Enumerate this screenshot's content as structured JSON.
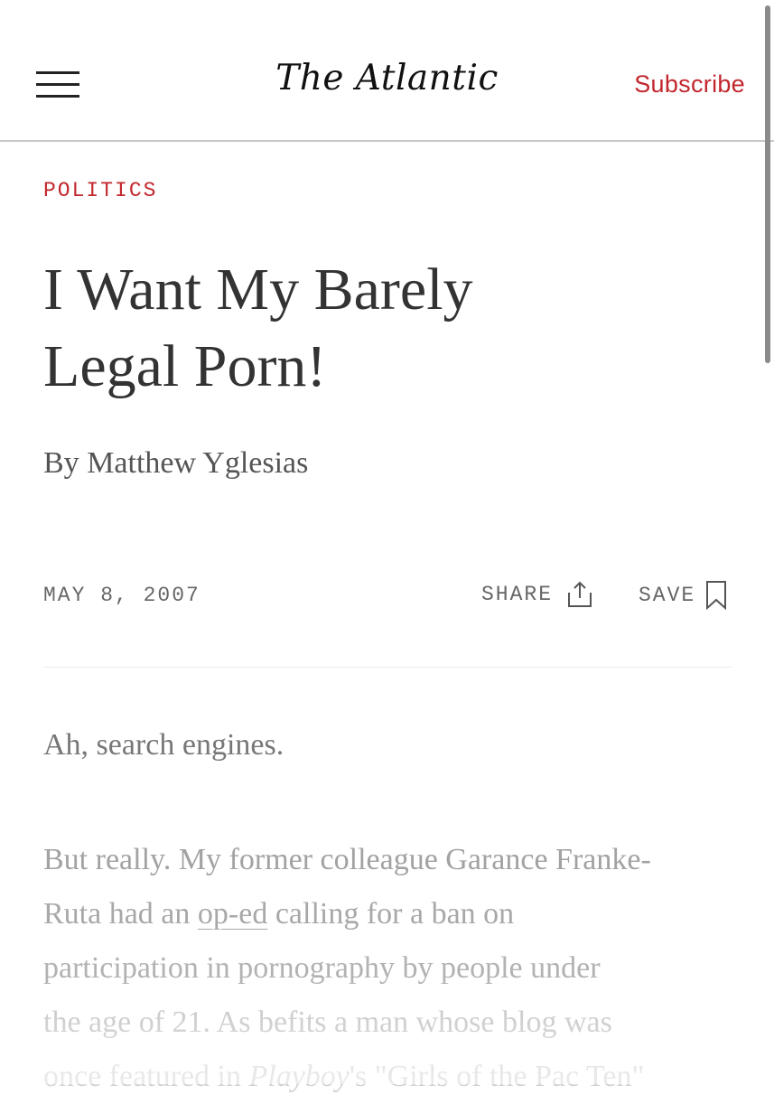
{
  "header": {
    "logo": "The Atlantic",
    "subscribe_label": "Subscribe",
    "menu_icon": "hamburger-menu-icon"
  },
  "article": {
    "section": "POLITICS",
    "title_line1": "I Want My Barely",
    "title_line2": "Legal Porn!",
    "byline_prefix": "By ",
    "author": "Matthew Yglesias",
    "date": "MAY 8, 2007",
    "share_label": "SHARE",
    "share_icon": "share-upload-icon",
    "save_label": "SAVE",
    "save_icon": "bookmark-icon",
    "paragraph1": "Ah, search engines.",
    "paragraph2": {
      "line1": "But really. My former colleague Garance Franke-",
      "line2_pre": "Ruta had an ",
      "line2_link": "op-ed",
      "line2_post": " calling for a ban on",
      "line3": "participation in pornography by people under",
      "line4": "the age of 21. As befits a man whose blog was",
      "line5_pre": "once featured in ",
      "line5_italic": "Playboy",
      "line5_post": "'s \"Girls of the Pac Ten\""
    }
  },
  "colors": {
    "accent": "#c2272d",
    "title_text": "#333333",
    "muted_text": "#666666"
  }
}
